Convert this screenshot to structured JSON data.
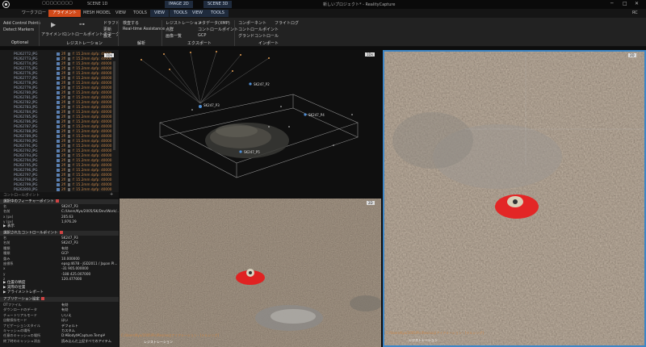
{
  "window": {
    "title": "新しいプロジェクト* - RealityCapture",
    "help_label": "RC",
    "tabs": [
      {
        "label": "ワークフロー"
      },
      {
        "label": "アライメント"
      },
      {
        "label": "MESH MODEL"
      },
      {
        "label": "VIEW"
      },
      {
        "label": "TOOLS"
      },
      {
        "label": "VIEW"
      },
      {
        "label": "TOOLS"
      },
      {
        "label": "VIEW"
      },
      {
        "label": "TOOLS"
      }
    ],
    "scene_tabs": [
      {
        "label": "SCENE 1D"
      },
      {
        "label": "IMAGE 2D"
      },
      {
        "label": "SCENE 3D"
      }
    ]
  },
  "ribbon": {
    "optional": {
      "items": [
        "Add Control Points",
        "Detect Markers"
      ],
      "group": "Optional"
    },
    "registration": {
      "items": [
        "アライメント",
        "コントロールポイントのマーク",
        "ドラフト",
        "更新",
        "設定"
      ],
      "group": "レジストレーション"
    },
    "analysis": {
      "items": [
        "検査する",
        "Real-time Assistance"
      ],
      "group": "解析"
    },
    "export": {
      "items": [
        "レジストレーション",
        "点群",
        "画像一覧",
        "メタデータ(XMP)",
        "コントロールポイント",
        "GCP"
      ],
      "group": "エクスポート"
    },
    "import": {
      "items": [
        "コンポーネント",
        "フライトログ",
        "コントロールポイント",
        "グランドコントロール"
      ],
      "group": "インポート"
    }
  },
  "tree": {
    "badge": "1Dx",
    "rows": [
      {
        "name": "P6262772.JPG",
        "stat": "2fl",
        "focal": "f: 15.2mm  dpfp: 40000"
      },
      {
        "name": "P6262773.JPG",
        "stat": "2fl",
        "focal": "f: 15.2mm  dpfp: 40000"
      },
      {
        "name": "P6262774.JPG",
        "stat": "2fl",
        "focal": "f: 15.2mm  dpfp: 40000"
      },
      {
        "name": "P6262775.JPG",
        "stat": "2fl",
        "focal": "f: 15.2mm  dpfp: 40000"
      },
      {
        "name": "P6262776.JPG",
        "stat": "2fl",
        "focal": "f: 15.2mm  dpfp: 40000"
      },
      {
        "name": "P6262777.JPG",
        "stat": "2fl",
        "focal": "f: 15.2mm  dpfp: 40000"
      },
      {
        "name": "P6262778.JPG",
        "stat": "2fl",
        "focal": "f: 15.2mm  dpfp: 40000"
      },
      {
        "name": "P6262779.JPG",
        "stat": "2fl",
        "focal": "f: 15.2mm  dpfp: 40000"
      },
      {
        "name": "P6262780.JPG",
        "stat": "2fl",
        "focal": "f: 15.2mm  dpfp: 40000"
      },
      {
        "name": "P6262781.JPG",
        "stat": "2fl",
        "focal": "f: 15.2mm  dpfp: 40000"
      },
      {
        "name": "P6262782.JPG",
        "stat": "2fl",
        "focal": "f: 15.2mm  dpfp: 40000"
      },
      {
        "name": "P6262783.JPG",
        "stat": "2fl",
        "focal": "f: 15.2mm  dpfp: 40000"
      },
      {
        "name": "P6262784.JPG",
        "stat": "2fl",
        "focal": "f: 15.2mm  dpfp: 40000"
      },
      {
        "name": "P6262785.JPG",
        "stat": "2fl",
        "focal": "f: 15.2mm  dpfp: 40000"
      },
      {
        "name": "P6262786.JPG",
        "stat": "2fl",
        "focal": "f: 15.2mm  dpfp: 40000"
      },
      {
        "name": "P6262787.JPG",
        "stat": "2fl",
        "focal": "f: 15.2mm  dpfp: 40000"
      },
      {
        "name": "P6262788.JPG",
        "stat": "2fl",
        "focal": "f: 15.2mm  dpfp: 40000"
      },
      {
        "name": "P6262789.JPG",
        "stat": "2fl",
        "focal": "f: 15.2mm  dpfp: 40000"
      },
      {
        "name": "P6262790.JPG",
        "stat": "2fl",
        "focal": "f: 15.2mm  dpfp: 40000"
      },
      {
        "name": "P6262791.JPG",
        "stat": "2fl",
        "focal": "f: 15.2mm  dpfp: 40000"
      },
      {
        "name": "P6262792.JPG",
        "stat": "2fl",
        "focal": "f: 15.2mm  dpfp: 40000"
      },
      {
        "name": "P6262793.JPG",
        "stat": "2fl",
        "focal": "f: 15.2mm  dpfp: 40000"
      },
      {
        "name": "P6262794.JPG",
        "stat": "2fl",
        "focal": "f: 15.2mm  dpfp: 40000"
      },
      {
        "name": "P6262795.JPG",
        "stat": "2fl",
        "focal": "f: 15.2mm  dpfp: 40000"
      },
      {
        "name": "P6262796.JPG",
        "stat": "2fl",
        "focal": "f: 15.2mm  dpfp: 40000"
      },
      {
        "name": "P6262797.JPG",
        "stat": "2fl",
        "focal": "f: 15.2mm  dpfp: 40000"
      },
      {
        "name": "P6262798.JPG",
        "stat": "2fl",
        "focal": "f: 15.2mm  dpfp: 40000"
      },
      {
        "name": "P6262799.JPG",
        "stat": "2fl",
        "focal": "f: 15.2mm  dpfp: 40000"
      },
      {
        "name": "P6262800.JPG",
        "stat": "2fl",
        "focal": "f: 15.2mm  dpfp: 40000"
      }
    ],
    "footer": "コントロールポイント"
  },
  "view3d": {
    "badge": "1Dx",
    "labels": [
      "SK247_P3",
      "SK247_P2",
      "SK247_P4",
      "SK247_P5"
    ]
  },
  "view2d": {
    "badge": "2D",
    "caption": "C:/Users/Kyo/2005/Pic/Res/xxはアイアメーション・[テルシング]",
    "layer": "レジストレーション"
  },
  "viewRight": {
    "badge": "2D",
    "caption": "C:/Users/Kyo/2005/Pic/Res/xxはアイアメーション・[テルシング]",
    "layer": "レジストレーション"
  },
  "props": {
    "section1": "選択中のフィーチャーポイント",
    "s1rows": [
      {
        "k": "名",
        "v": "SK247_P3"
      },
      {
        "k": "名前",
        "v": "C:/Users/Kyo/2005/SK/Dev/Work/..."
      },
      {
        "k": "x (px)",
        "v": "205.63"
      },
      {
        "k": "y (px)",
        "v": "1,976.29"
      }
    ],
    "sub1": "▶ 表示",
    "section2": "選択されたコントロールポイント",
    "s2rows": [
      {
        "k": "名",
        "v": "SK247_P3"
      },
      {
        "k": "名前",
        "v": "SK247_P3"
      },
      {
        "k": "種類",
        "v": "有効"
      },
      {
        "k": "種類",
        "v": "GCP"
      },
      {
        "k": "重み",
        "v": "10.000000"
      },
      {
        "k": "座標系",
        "v": "epsg:4678 - JGD2011 / Japan Pl..."
      },
      {
        "k": "x",
        "v": "-31 905.000000"
      },
      {
        "k": "y",
        "v": "-188 425.007000"
      },
      {
        "k": "z",
        "v": "120.477000"
      }
    ],
    "sub2": [
      "▶ 位置の精度",
      "▶ 実際の位置",
      "▶ アライメントレポート"
    ],
    "section3": "アプリケーション設定",
    "s3rows": [
      {
        "k": "OTファイル",
        "v": "有効"
      },
      {
        "k": "ダウンロードのデータ",
        "v": "有効"
      },
      {
        "k": "チュートリアルモード",
        "v": "いいえ"
      },
      {
        "k": "自動保存モード",
        "v": "はい"
      },
      {
        "k": "ナビゲーションスタイル",
        "v": "デフォルト"
      },
      {
        "k": "キャッシュの場所",
        "v": "カスタム"
      },
      {
        "k": "任意のキャッシュの場所",
        "v": "D:¥Bodyt¥Capture.Temp¥"
      },
      {
        "k": "終了時のキャッシュ消去",
        "v": "読み込んだ上記すべてのアイテム"
      }
    ]
  }
}
